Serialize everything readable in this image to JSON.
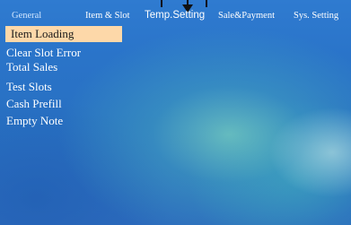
{
  "tabs": [
    {
      "label": "General"
    },
    {
      "label": "Item & Slot"
    },
    {
      "label": "Temp.Setting"
    },
    {
      "label": "Sale&Payment"
    },
    {
      "label": "Sys. Setting"
    }
  ],
  "submenu": {
    "selected": "Item Loading",
    "items": [
      {
        "label": "Item Loading"
      },
      {
        "label": "Clear Slot Error"
      },
      {
        "label": "Total Sales"
      },
      {
        "label": "Test Slots"
      },
      {
        "label": "Cash Prefill"
      },
      {
        "label": "Empty Note"
      }
    ]
  },
  "colors": {
    "background": "#2a74c9",
    "selected_highlight": "#fdd8a9",
    "active_tab_text": "#d0e6ff",
    "text": "#ffffff"
  },
  "icons": {
    "marker": "down-arrow-icon"
  }
}
